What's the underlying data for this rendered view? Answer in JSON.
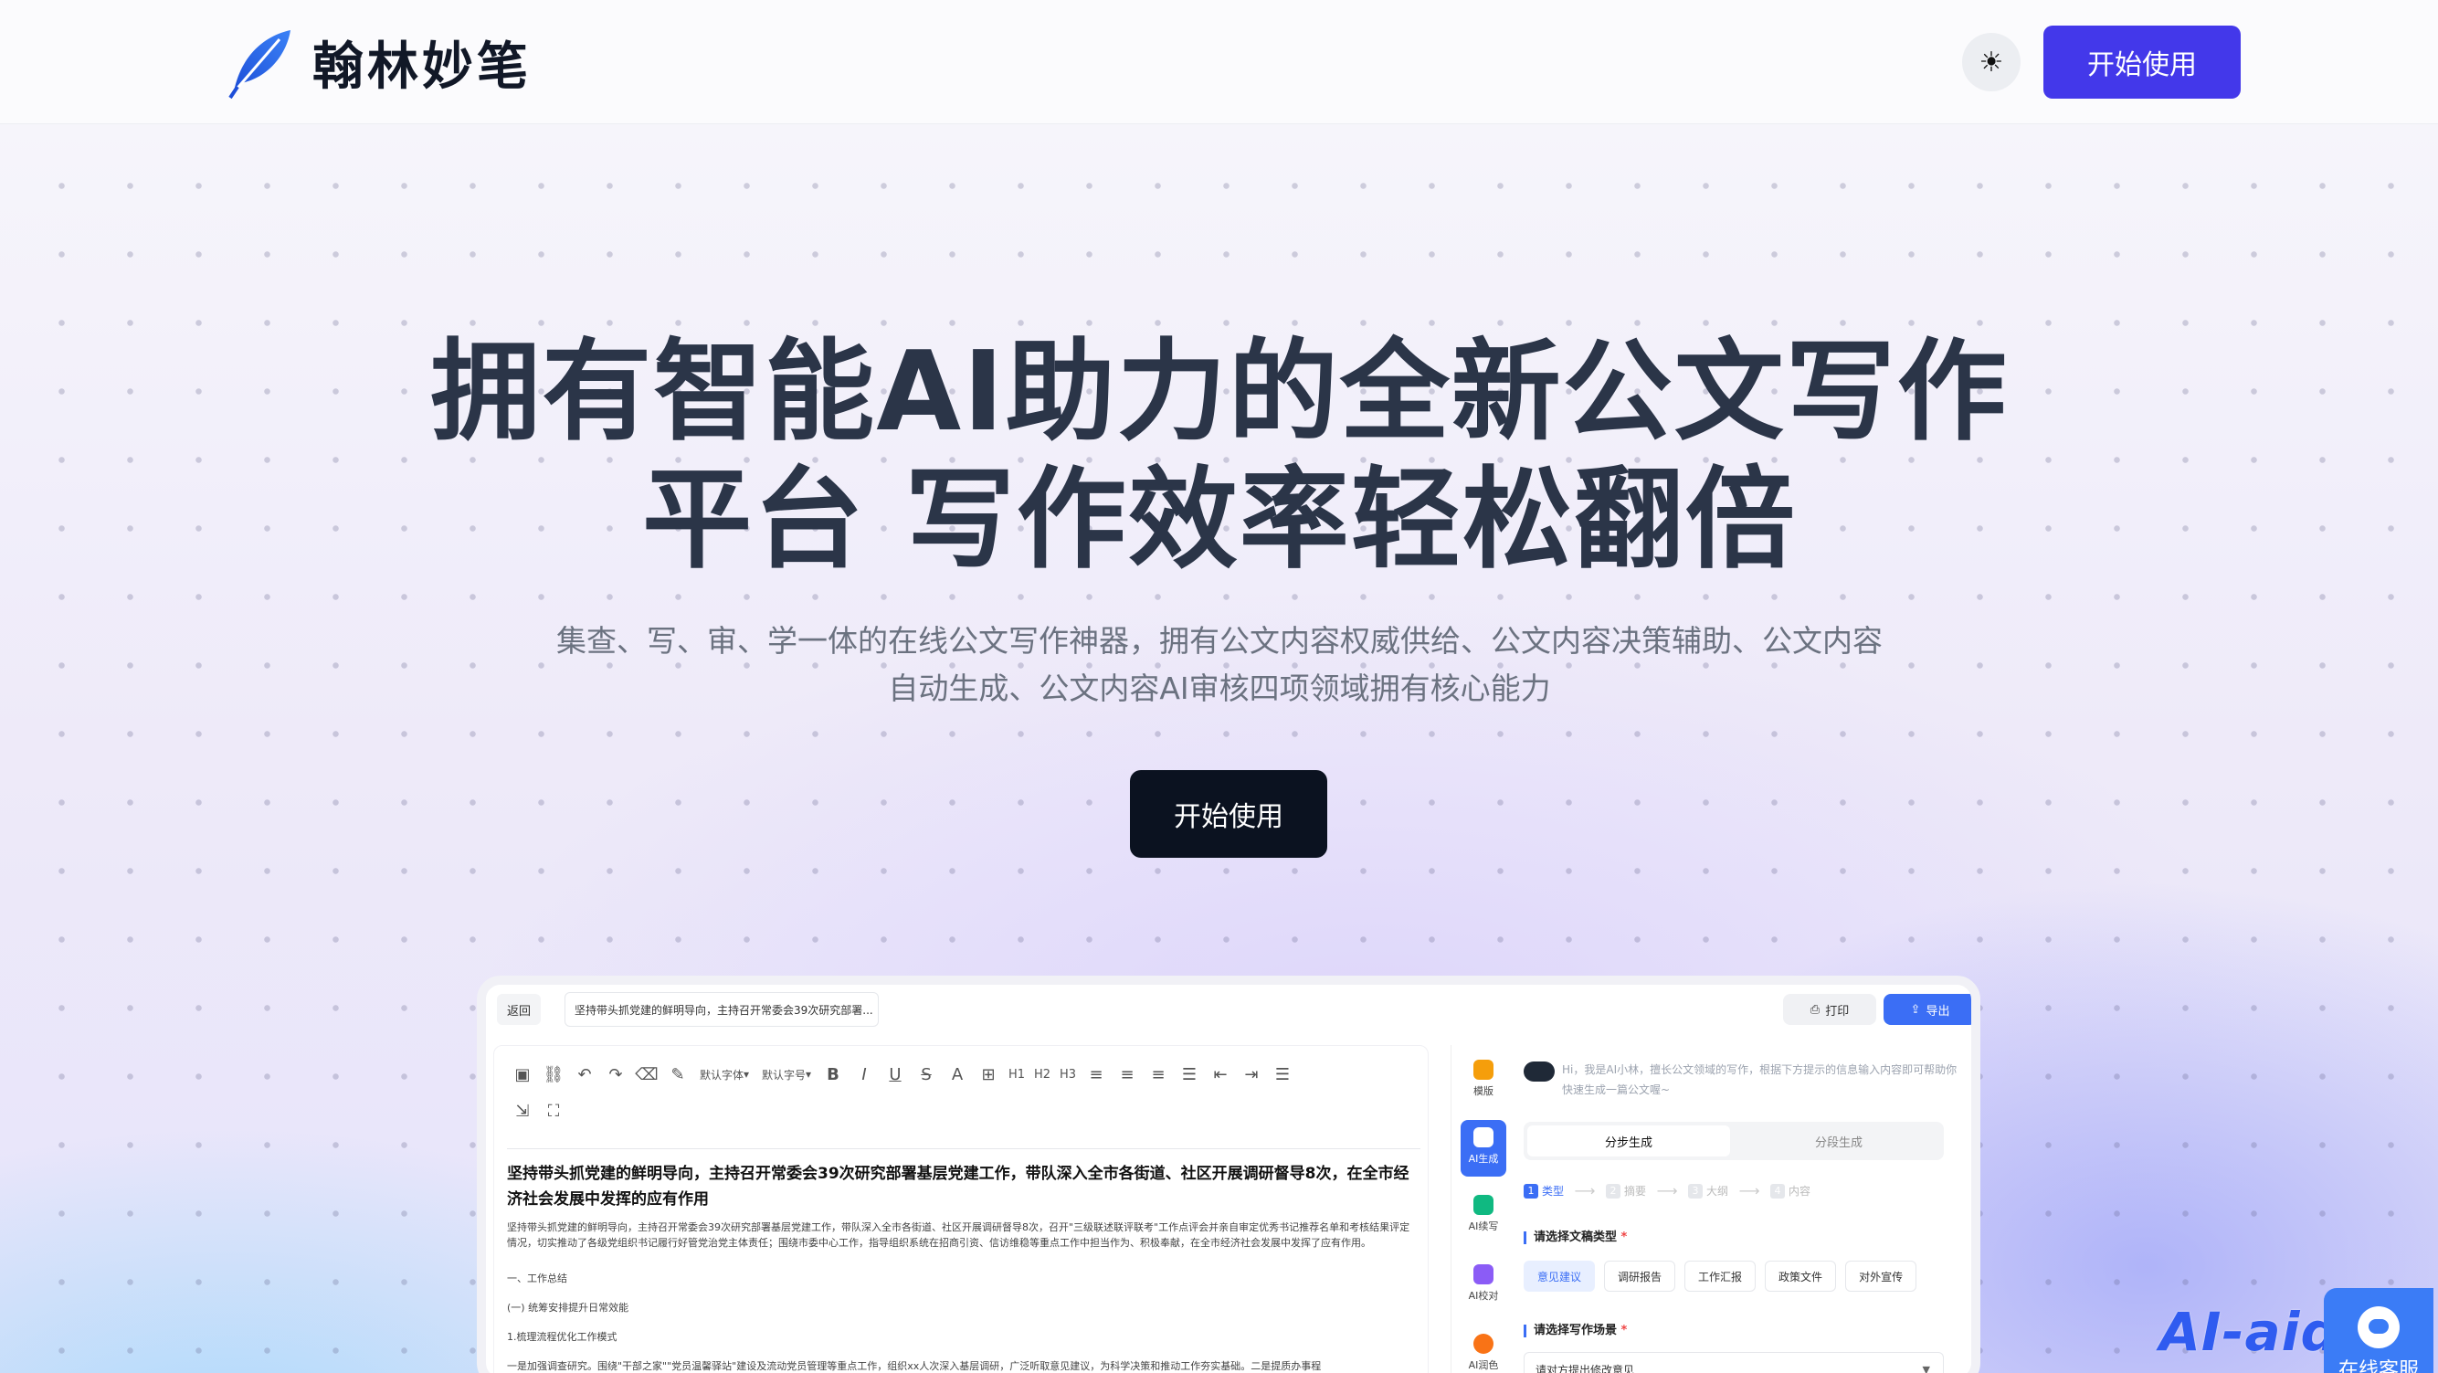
{
  "brand": {
    "name": "翰林妙笔",
    "accent": "#4338ea"
  },
  "nav": {
    "theme_icon": "sun-icon",
    "cta": "开始使用"
  },
  "hero": {
    "title_line1": "拥有智能AI助力的全新公文写作",
    "title_line2": "平台 写作效率轻松翻倍",
    "subtitle_line1": "集查、写、审、学一体的在线公文写作神器，拥有公文内容权威供给、公文内容决策辅助、公文内容",
    "subtitle_line2": "自动生成、公文内容AI审核四项领域拥有核心能力",
    "cta": "开始使用"
  },
  "editor": {
    "back": "返回",
    "doc_title": "坚持带头抓党建的鲜明导向，主持召开常委会39次研究部署...",
    "print": "打印",
    "export": "导出",
    "toolbar": {
      "font_family": "默认字体",
      "font_size": "默认字号",
      "h1": "H1",
      "h2": "H2",
      "h3": "H3"
    },
    "heading": "坚持带头抓党建的鲜明导向，主持召开常委会39次研究部署基层党建工作，带队深入全市各街道、社区开展调研督导8次，在全市经济社会发展中发挥的应有作用",
    "paragraph": "坚持带头抓党建的鲜明导向，主持召开常委会39次研究部署基层党建工作，带队深入全市各街道、社区开展调研督导8次，召开\"三级联述联评联考\"工作点评会并亲自审定优秀书记推荐名单和考核结果评定情况，切实推动了各级党组织书记履行好管党治党主体责任；围绕市委中心工作，指导组织系统在招商引资、信访维稳等重点工作中担当作为、积极奉献，在全市经济社会发展中发挥了应有作用。",
    "line1": "一、工作总结",
    "line2": "(一) 统筹安排提升日常效能",
    "line3": "1.梳理流程优化工作模式",
    "line4": "一是加强调查研究。围绕\"干部之家\"\"党员温馨驿站\"建设及流动党员管理等重点工作，组织xx人次深入基层调研，广泛听取意见建议，为科学决策和推动工作夯实基础。二是提质办事程"
  },
  "ai_panel": {
    "side": [
      {
        "label": "模版",
        "icon": "template-icon"
      },
      {
        "label": "AI生成",
        "icon": "robot-icon"
      },
      {
        "label": "AI续写",
        "icon": "pen-icon"
      },
      {
        "label": "AI校对",
        "icon": "check-icon"
      },
      {
        "label": "AI润色",
        "icon": "polish-icon"
      }
    ],
    "greeting": "Hi，我是AI小林，擅长公文领域的写作，根据下方提示的信息输入内容即可帮助你快速生成一篇公文喔~",
    "tab_step": "分步生成",
    "tab_segment": "分段生成",
    "steps": [
      "类型",
      "摘要",
      "大纲",
      "内容"
    ],
    "type_label": "请选择文稿类型",
    "types": [
      "意见建议",
      "调研报告",
      "工作汇报",
      "政策文件",
      "对外宣传"
    ],
    "scene_label": "请选择写作场景",
    "scene_value": "请对方提出修改意见",
    "required_mark": "*"
  },
  "watermark": "AI-aide",
  "support": {
    "label": "在线客服"
  }
}
